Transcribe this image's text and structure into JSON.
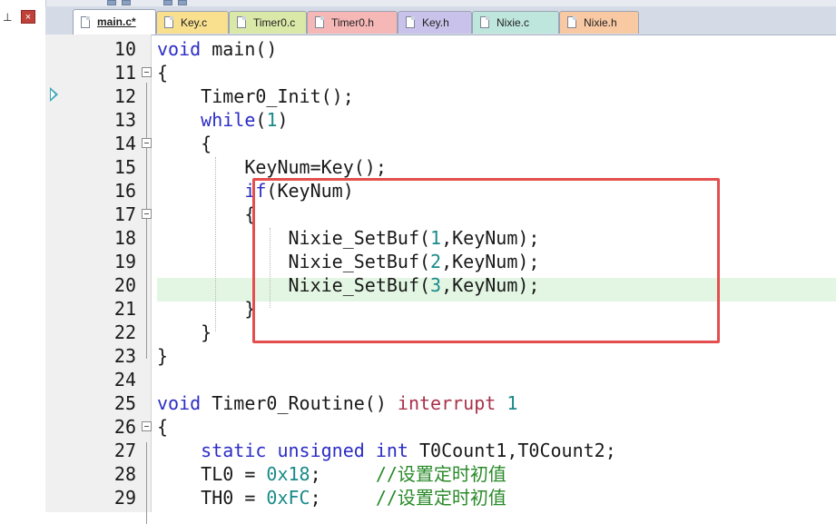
{
  "panel": {
    "pin_glyph": "⊥",
    "close_glyph": "×"
  },
  "tabs": [
    {
      "label": "main.c*",
      "active": true,
      "color": "#ffffff"
    },
    {
      "label": "Key.c",
      "active": false,
      "color": "#f9e08f"
    },
    {
      "label": "Timer0.c",
      "active": false,
      "color": "#dbe9a8"
    },
    {
      "label": "Timer0.h",
      "active": false,
      "color": "#f6b7b7"
    },
    {
      "label": "Key.h",
      "active": false,
      "color": "#c9c2ea"
    },
    {
      "label": "Nixie.c",
      "active": false,
      "color": "#bfe6dc"
    },
    {
      "label": "Nixie.h",
      "active": false,
      "color": "#f9c9a4"
    }
  ],
  "editor": {
    "current_line": 20,
    "execution_marker_line": 12,
    "highlight_box_color": "#e44e4e",
    "lines": [
      {
        "n": "10",
        "tokens": [
          {
            "t": "void",
            "c": "kw"
          },
          {
            "t": " main()",
            "c": ""
          }
        ]
      },
      {
        "n": "11",
        "tokens": [
          {
            "t": "{",
            "c": ""
          }
        ]
      },
      {
        "n": "12",
        "tokens": [
          {
            "t": "    Timer0_Init();",
            "c": ""
          }
        ]
      },
      {
        "n": "13",
        "tokens": [
          {
            "t": "    ",
            "c": ""
          },
          {
            "t": "while",
            "c": "kw"
          },
          {
            "t": "(",
            "c": ""
          },
          {
            "t": "1",
            "c": "num"
          },
          {
            "t": ")",
            "c": ""
          }
        ]
      },
      {
        "n": "14",
        "tokens": [
          {
            "t": "    {",
            "c": ""
          }
        ]
      },
      {
        "n": "15",
        "tokens": [
          {
            "t": "        KeyNum=Key();",
            "c": ""
          }
        ]
      },
      {
        "n": "16",
        "tokens": [
          {
            "t": "        ",
            "c": ""
          },
          {
            "t": "if",
            "c": "kw"
          },
          {
            "t": "(KeyNum)",
            "c": ""
          }
        ]
      },
      {
        "n": "17",
        "tokens": [
          {
            "t": "        {",
            "c": ""
          }
        ]
      },
      {
        "n": "18",
        "tokens": [
          {
            "t": "            Nixie_SetBuf(",
            "c": ""
          },
          {
            "t": "1",
            "c": "num"
          },
          {
            "t": ",KeyNum);",
            "c": ""
          }
        ]
      },
      {
        "n": "19",
        "tokens": [
          {
            "t": "            Nixie_SetBuf(",
            "c": ""
          },
          {
            "t": "2",
            "c": "num"
          },
          {
            "t": ",KeyNum);",
            "c": ""
          }
        ]
      },
      {
        "n": "20",
        "tokens": [
          {
            "t": "            Nixie_SetBuf(",
            "c": ""
          },
          {
            "t": "3",
            "c": "num"
          },
          {
            "t": ",KeyNum);",
            "c": ""
          }
        ]
      },
      {
        "n": "21",
        "tokens": [
          {
            "t": "        }",
            "c": ""
          }
        ]
      },
      {
        "n": "22",
        "tokens": [
          {
            "t": "    }",
            "c": ""
          }
        ]
      },
      {
        "n": "23",
        "tokens": [
          {
            "t": "}",
            "c": ""
          }
        ]
      },
      {
        "n": "24",
        "tokens": []
      },
      {
        "n": "25",
        "tokens": [
          {
            "t": "void",
            "c": "kw"
          },
          {
            "t": " Timer0_Routine() ",
            "c": ""
          },
          {
            "t": "interrupt",
            "c": "kw2"
          },
          {
            "t": " ",
            "c": ""
          },
          {
            "t": "1",
            "c": "num"
          }
        ]
      },
      {
        "n": "26",
        "tokens": [
          {
            "t": "{",
            "c": ""
          }
        ]
      },
      {
        "n": "27",
        "tokens": [
          {
            "t": "    ",
            "c": ""
          },
          {
            "t": "static",
            "c": "kw"
          },
          {
            "t": " ",
            "c": ""
          },
          {
            "t": "unsigned",
            "c": "kw"
          },
          {
            "t": " ",
            "c": ""
          },
          {
            "t": "int",
            "c": "kw"
          },
          {
            "t": " T0Count1,T0Count2;",
            "c": ""
          }
        ]
      },
      {
        "n": "28",
        "tokens": [
          {
            "t": "    TL0 = ",
            "c": ""
          },
          {
            "t": "0x18",
            "c": "num"
          },
          {
            "t": ";     ",
            "c": ""
          },
          {
            "t": "//设置定时初值",
            "c": "cm"
          }
        ]
      },
      {
        "n": "29",
        "tokens": [
          {
            "t": "    TH0 = ",
            "c": ""
          },
          {
            "t": "0xFC",
            "c": "num"
          },
          {
            "t": ";     ",
            "c": ""
          },
          {
            "t": "//设置定时初值",
            "c": "cm"
          }
        ]
      }
    ]
  }
}
